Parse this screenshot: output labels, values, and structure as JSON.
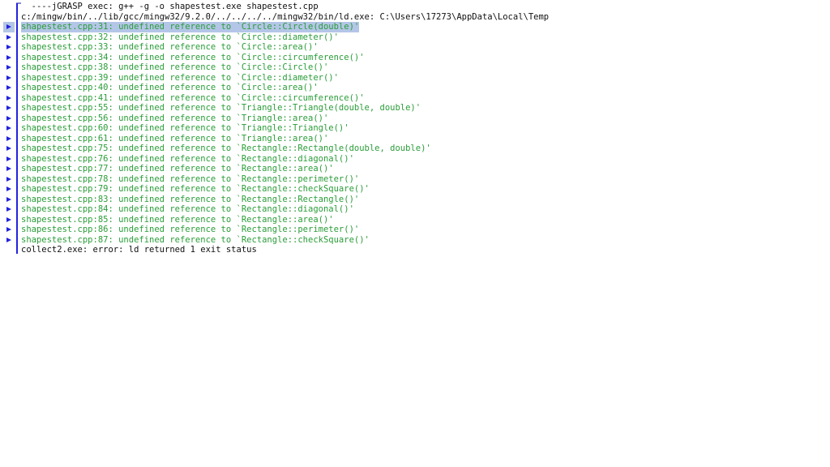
{
  "pane": {
    "name": "jgrasp-compile-messages",
    "colors": {
      "background": "#ffffff",
      "error_text": "#2a9d38",
      "plain_text": "#101010",
      "marker": "#2222dd",
      "rail": "#2222dd",
      "selection": "#b4c6e7"
    }
  },
  "lines": [
    {
      "text": "  ----jGRASP exec: g++ -g -o shapestest.exe shapestest.cpp",
      "kind": "plain",
      "marker": false,
      "selected": false
    },
    {
      "text": "c:/mingw/bin/../lib/gcc/mingw32/9.2.0/../../../../mingw32/bin/ld.exe: C:\\Users\\17273\\AppData\\Local\\Temp",
      "kind": "plain",
      "marker": false,
      "selected": false
    },
    {
      "text": "shapestest.cpp:31: undefined reference to `Circle::Circle(double)'",
      "kind": "error",
      "marker": true,
      "selected": true
    },
    {
      "text": "shapestest.cpp:32: undefined reference to `Circle::diameter()'",
      "kind": "error",
      "marker": true,
      "selected": false
    },
    {
      "text": "shapestest.cpp:33: undefined reference to `Circle::area()'",
      "kind": "error",
      "marker": true,
      "selected": false
    },
    {
      "text": "shapestest.cpp:34: undefined reference to `Circle::circumference()'",
      "kind": "error",
      "marker": true,
      "selected": false
    },
    {
      "text": "shapestest.cpp:38: undefined reference to `Circle::Circle()'",
      "kind": "error",
      "marker": true,
      "selected": false
    },
    {
      "text": "shapestest.cpp:39: undefined reference to `Circle::diameter()'",
      "kind": "error",
      "marker": true,
      "selected": false
    },
    {
      "text": "shapestest.cpp:40: undefined reference to `Circle::area()'",
      "kind": "error",
      "marker": true,
      "selected": false
    },
    {
      "text": "shapestest.cpp:41: undefined reference to `Circle::circumference()'",
      "kind": "error",
      "marker": true,
      "selected": false
    },
    {
      "text": "shapestest.cpp:55: undefined reference to `Triangle::Triangle(double, double)'",
      "kind": "error",
      "marker": true,
      "selected": false
    },
    {
      "text": "shapestest.cpp:56: undefined reference to `Triangle::area()'",
      "kind": "error",
      "marker": true,
      "selected": false
    },
    {
      "text": "shapestest.cpp:60: undefined reference to `Triangle::Triangle()'",
      "kind": "error",
      "marker": true,
      "selected": false
    },
    {
      "text": "shapestest.cpp:61: undefined reference to `Triangle::area()'",
      "kind": "error",
      "marker": true,
      "selected": false
    },
    {
      "text": "shapestest.cpp:75: undefined reference to `Rectangle::Rectangle(double, double)'",
      "kind": "error",
      "marker": true,
      "selected": false
    },
    {
      "text": "shapestest.cpp:76: undefined reference to `Rectangle::diagonal()'",
      "kind": "error",
      "marker": true,
      "selected": false
    },
    {
      "text": "shapestest.cpp:77: undefined reference to `Rectangle::area()'",
      "kind": "error",
      "marker": true,
      "selected": false
    },
    {
      "text": "shapestest.cpp:78: undefined reference to `Rectangle::perimeter()'",
      "kind": "error",
      "marker": true,
      "selected": false
    },
    {
      "text": "shapestest.cpp:79: undefined reference to `Rectangle::checkSquare()'",
      "kind": "error",
      "marker": true,
      "selected": false
    },
    {
      "text": "shapestest.cpp:83: undefined reference to `Rectangle::Rectangle()'",
      "kind": "error",
      "marker": true,
      "selected": false
    },
    {
      "text": "shapestest.cpp:84: undefined reference to `Rectangle::diagonal()'",
      "kind": "error",
      "marker": true,
      "selected": false
    },
    {
      "text": "shapestest.cpp:85: undefined reference to `Rectangle::area()'",
      "kind": "error",
      "marker": true,
      "selected": false
    },
    {
      "text": "shapestest.cpp:86: undefined reference to `Rectangle::perimeter()'",
      "kind": "error",
      "marker": true,
      "selected": false
    },
    {
      "text": "shapestest.cpp:87: undefined reference to `Rectangle::checkSquare()'",
      "kind": "error",
      "marker": true,
      "selected": false
    },
    {
      "text": "collect2.exe: error: ld returned 1 exit status",
      "kind": "plain",
      "marker": false,
      "selected": false
    }
  ]
}
